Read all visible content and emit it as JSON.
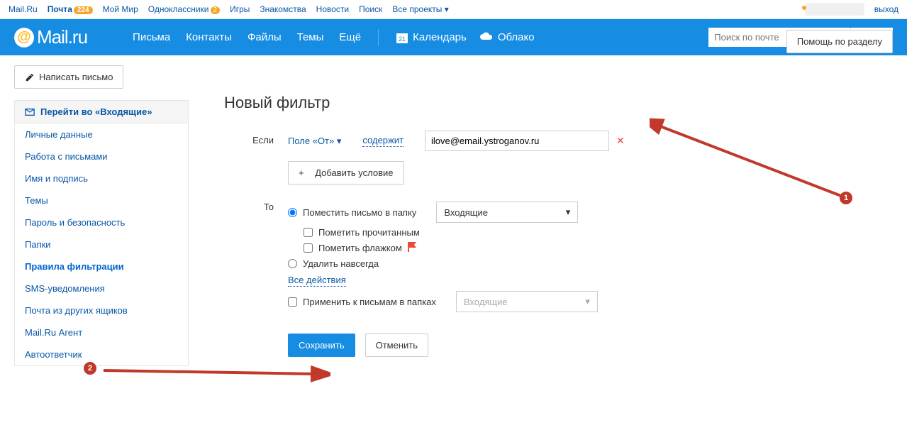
{
  "topbar": {
    "left": [
      {
        "label": "Mail.Ru",
        "active": false
      },
      {
        "label": "Почта",
        "badge": "224",
        "active": true
      },
      {
        "label": "Мой Мир",
        "active": false
      },
      {
        "label": "Одноклассники",
        "badge": "2",
        "badge_circle": true
      },
      {
        "label": "Игры"
      },
      {
        "label": "Знакомства"
      },
      {
        "label": "Новости"
      },
      {
        "label": "Поиск"
      },
      {
        "label": "Все проекты",
        "caret": true
      }
    ],
    "logout": "выход"
  },
  "header": {
    "logo": "mail.ru",
    "nav": [
      "Письма",
      "Контакты",
      "Файлы",
      "Темы",
      "Ещё"
    ],
    "calendar": {
      "label": "Календарь",
      "day": "21"
    },
    "cloud": "Облако",
    "search_placeholder": "Поиск по почте"
  },
  "toolbar": {
    "compose": "Написать письмо",
    "help": "Помощь по разделу"
  },
  "sidemenu": {
    "top": "Перейти во «Входящие»",
    "items": [
      {
        "label": "Личные данные"
      },
      {
        "label": "Работа с письмами"
      },
      {
        "label": "Имя и подпись"
      },
      {
        "label": "Темы"
      },
      {
        "label": "Пароль и безопасность"
      },
      {
        "label": "Папки"
      },
      {
        "label": "Правила фильтрации",
        "active": true
      },
      {
        "label": "SMS-уведомления"
      },
      {
        "label": "Почта из других ящиков"
      },
      {
        "label": "Mail.Ru Агент"
      },
      {
        "label": "Автоответчик"
      }
    ]
  },
  "page": {
    "title": "Новый фильтр",
    "if_label": "Если",
    "field_from": "Поле «От»",
    "contains": "содержит",
    "condition_value": "ilove@email.ystroganov.ru",
    "add_condition": "Добавить условие",
    "then_label": "То",
    "move_to": "Поместить письмо в папку",
    "folder": "Входящие",
    "mark_read": "Пометить прочитанным",
    "mark_flag": "Пометить флажком",
    "delete_forever": "Удалить навсегда",
    "all_actions": "Все действия",
    "apply_to": "Применить к письмам в папках",
    "apply_folder": "Входящие",
    "save": "Сохранить",
    "cancel": "Отменить"
  },
  "annotations": {
    "one": "1",
    "two": "2"
  }
}
